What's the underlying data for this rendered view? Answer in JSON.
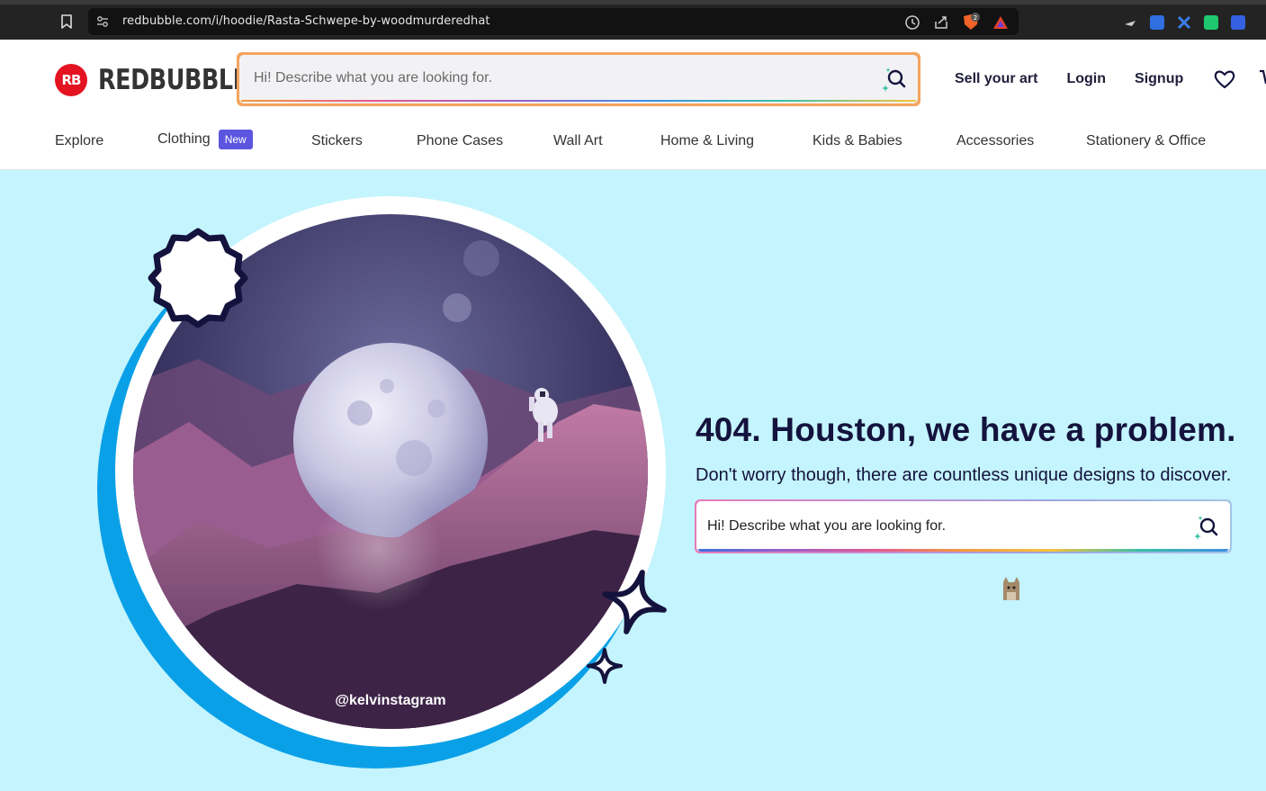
{
  "browser": {
    "url": "redbubble.com/i/hoodie/Rasta-Schwepe-by-woodmurderedhat",
    "extension_badge_count": "2"
  },
  "header": {
    "logo_mark": "RB",
    "logo_text": "REDBUBBLE",
    "search_placeholder": "Hi! Describe what you are looking for.",
    "links": {
      "sell": "Sell your art",
      "login": "Login",
      "signup": "Signup"
    }
  },
  "nav": {
    "items": [
      {
        "label": "Explore"
      },
      {
        "label": "Clothing",
        "badge": "New"
      },
      {
        "label": "Stickers"
      },
      {
        "label": "Phone Cases"
      },
      {
        "label": "Wall Art"
      },
      {
        "label": "Home & Living"
      },
      {
        "label": "Kids & Babies"
      },
      {
        "label": "Accessories"
      },
      {
        "label": "Stationery & Office"
      }
    ]
  },
  "hero": {
    "title": "404. Houston, we have a problem.",
    "subtitle": "Don't worry though, there are countless unique designs to discover.",
    "search_placeholder": "Hi! Describe what you are looking for.",
    "image_credit": "@kelvinstagram"
  },
  "colors": {
    "brand_red": "#e41321",
    "hero_bg": "#c4f4fd",
    "heading": "#14133d",
    "badge_new": "#5b55e0",
    "ring_blue": "#0aa0e8"
  }
}
